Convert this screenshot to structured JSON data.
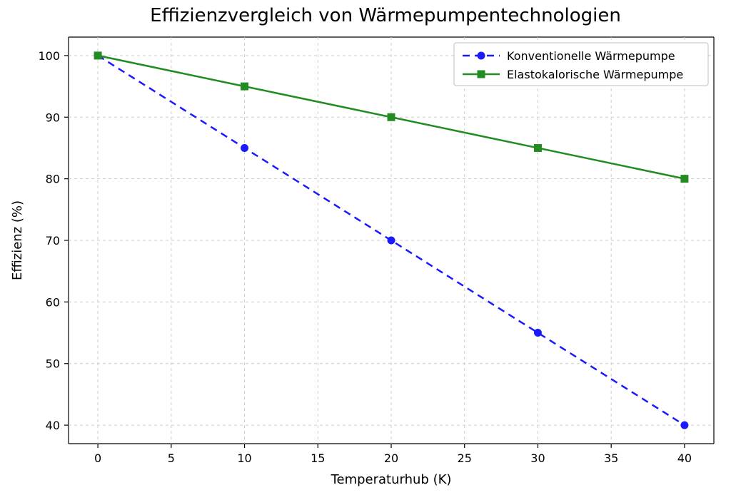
{
  "chart_data": {
    "type": "line",
    "title": "Effizienzvergleich von Wärmepumpentechnologien",
    "xlabel": "Temperaturhub (K)",
    "ylabel": "Effizienz (%)",
    "x": [
      0,
      10,
      20,
      30,
      40
    ],
    "x_ticks": [
      0,
      5,
      10,
      15,
      20,
      25,
      30,
      35,
      40
    ],
    "y_ticks": [
      40,
      50,
      60,
      70,
      80,
      90,
      100
    ],
    "xlim": [
      -2,
      42
    ],
    "ylim": [
      37,
      103
    ],
    "grid": true,
    "legend_position": "upper right",
    "series": [
      {
        "name": "Konventionelle Wärmepumpe",
        "values": [
          100,
          85,
          70,
          55,
          40
        ],
        "color": "#1a1aff",
        "style": "dashed",
        "marker": "circle"
      },
      {
        "name": "Elastokalorische Wärmepumpe",
        "values": [
          100,
          95,
          90,
          85,
          80
        ],
        "color": "#228B22",
        "style": "solid",
        "marker": "square"
      }
    ]
  }
}
